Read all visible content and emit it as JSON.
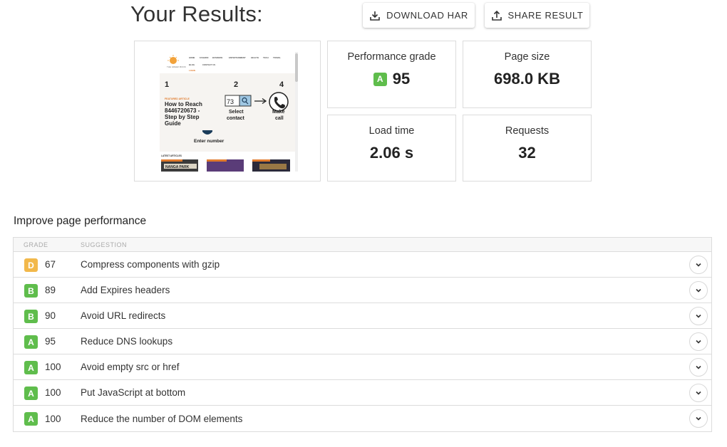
{
  "header": {
    "title": "Your Results:",
    "download_label": "DOWNLOAD HAR",
    "share_label": "SHARE RESULT"
  },
  "metrics": {
    "grade_label": "Performance grade",
    "grade_letter": "A",
    "grade_value": "95",
    "size_label": "Page size",
    "size_value": "698.0 KB",
    "load_label": "Load time",
    "load_value": "2.06 s",
    "requests_label": "Requests",
    "requests_value": "32"
  },
  "thumbnail": {
    "logo_text": "THE GREEK BOOK",
    "nav_items": [
      "HOME",
      "FASHION",
      "BUSINESS",
      "ENTERTAINMENT",
      "HEALTH",
      "TECH",
      "TRAVEL"
    ],
    "nav_items2": [
      "BLOG",
      "CONTACT US"
    ],
    "nav_extra": "LOGIN",
    "step1": "1",
    "step2": "2",
    "step4": "4",
    "tag": "FEATURED ARTICLE",
    "headline": "How to Reach 8446720673 - Step by Step Guide",
    "input_digits": "73",
    "select_label": "Select contact",
    "make_label": "Make call",
    "enter_label": "Enter number",
    "latest_label": "LATEST ARTICLES",
    "article_text": "NANGA PARK"
  },
  "improve": {
    "title": "Improve page performance",
    "col_grade": "GRADE",
    "col_suggestion": "SUGGESTION",
    "rows": [
      {
        "grade": "D",
        "score": "67",
        "suggestion": "Compress components with gzip"
      },
      {
        "grade": "B",
        "score": "89",
        "suggestion": "Add Expires headers"
      },
      {
        "grade": "B",
        "score": "90",
        "suggestion": "Avoid URL redirects"
      },
      {
        "grade": "A",
        "score": "95",
        "suggestion": "Reduce DNS lookups"
      },
      {
        "grade": "A",
        "score": "100",
        "suggestion": "Avoid empty src or href"
      },
      {
        "grade": "A",
        "score": "100",
        "suggestion": "Put JavaScript at bottom"
      },
      {
        "grade": "A",
        "score": "100",
        "suggestion": "Reduce the number of DOM elements"
      }
    ]
  },
  "colors": {
    "grade_a": "#5fbd4c",
    "grade_b": "#5fbd4c",
    "grade_d": "#f2b84b"
  },
  "icons": {
    "download": "download-icon",
    "share": "share-icon",
    "expand": "chevron-down-icon"
  }
}
